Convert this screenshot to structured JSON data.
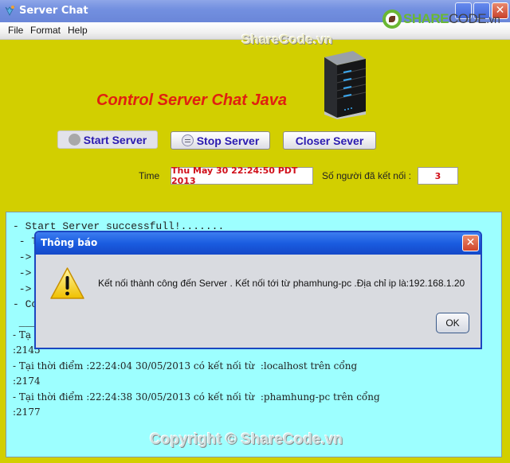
{
  "window": {
    "title": "Server Chat",
    "controls": {
      "close_glyph": "✕"
    }
  },
  "menu": {
    "items": [
      "File",
      "Format",
      "Help"
    ]
  },
  "watermarks": {
    "top": "ShareCode.vn",
    "logo_share": "SHARE",
    "logo_code": "CODE",
    "logo_vn": ".vn",
    "bottom": "Copyright © ShareCode.vn"
  },
  "header": {
    "title": "Control Server Chat Java"
  },
  "toolbar": {
    "start_label": "Start Server",
    "stop_label": "Stop Server",
    "close_label": "Closer Sever"
  },
  "status": {
    "time_label": "Time",
    "time_value": "Thu May 30 22:24:50 PDT 2013",
    "connected_label": "Số người đã kết nối :",
    "connected_value": "3"
  },
  "log": {
    "lines": [
      "- Start Server successfull!.......",
      " - T",
      " ->",
      " ->",
      " ->",
      "- Co",
      " ___",
      "- Tạ",
      ":2145",
      "- Tại thời điểm :22:24:04 30/05/2013 có kết nối từ  :localhost trên cổng",
      ":2174",
      "- Tại thời điểm :22:24:38 30/05/2013 có kết nối từ  :phamhung-pc trên cổng",
      ":2177"
    ]
  },
  "dialog": {
    "title": "Thông báo",
    "message": "Kết nối thành công đến Server . Kết nối tới từ  phamhung-pc .Địa  chỉ ip là:192.168.1.20",
    "ok_label": "OK",
    "close_glyph": "✕",
    "icon": "warning-icon"
  },
  "colors": {
    "background": "#d2cf00",
    "log_background": "#9dffff",
    "heading": "#e02010",
    "button_text": "#2a1ab0",
    "field_text": "#d0101a"
  }
}
